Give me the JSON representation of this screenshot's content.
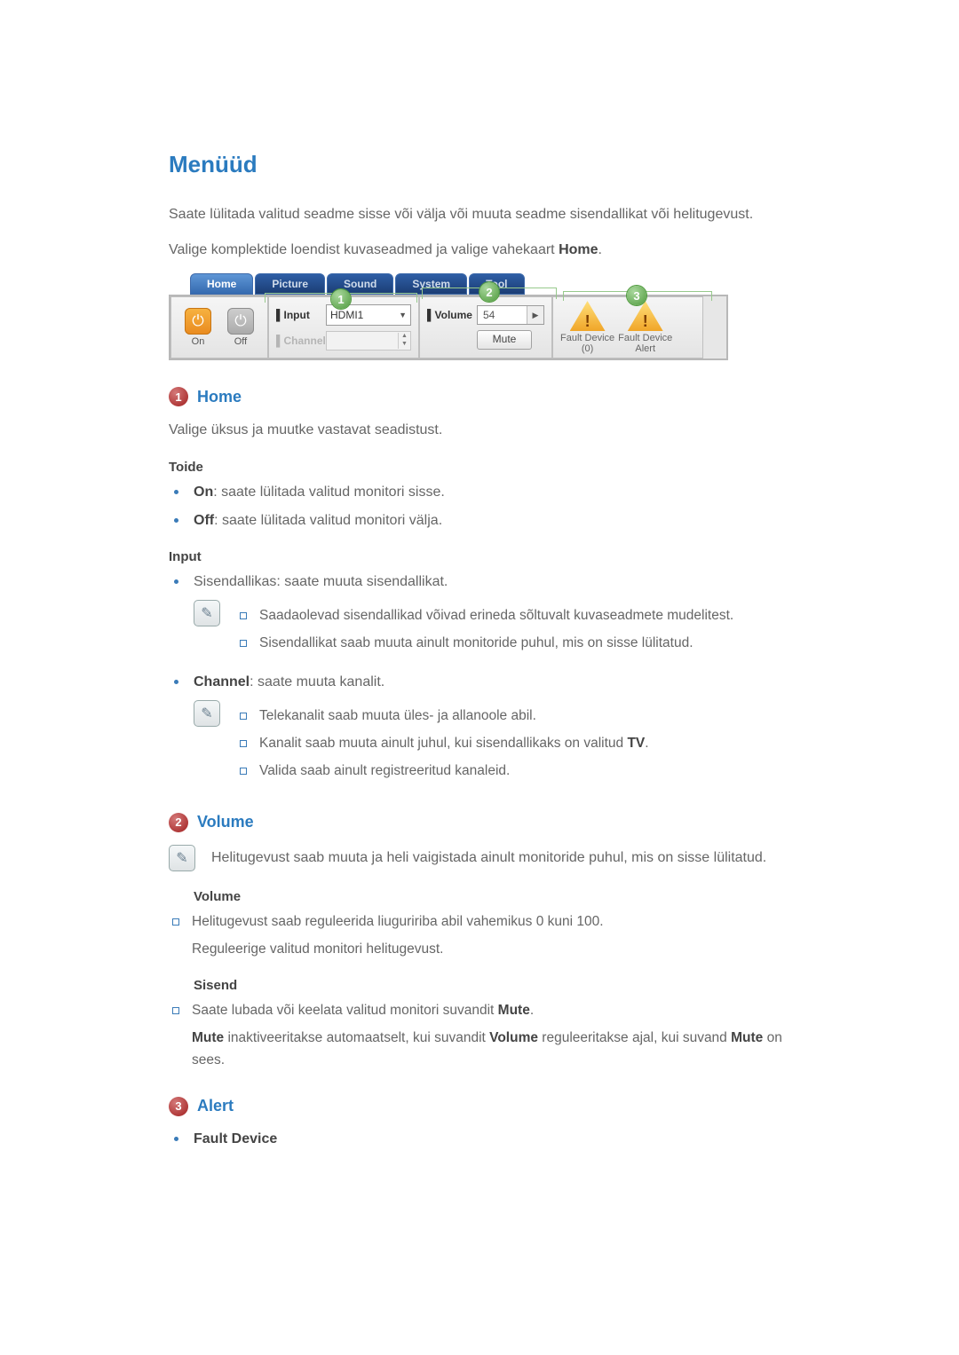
{
  "title": "Menüüd",
  "intro1": "Saate lülitada valitud seadme sisse või välja või muuta seadme sisendallikat või helitugevust.",
  "intro2_pre": "Valige komplektide loendist kuvaseadmed ja valige vahekaart ",
  "intro2_bold": "Home",
  "intro2_post": ".",
  "panel": {
    "tabs": [
      "Home",
      "Picture",
      "Sound",
      "System",
      "Tool"
    ],
    "power": {
      "on": "On",
      "off": "Off"
    },
    "input": {
      "inputLabel": "Input",
      "inputValue": "HDMI1",
      "channelLabel": "Channel"
    },
    "volume": {
      "label": "Volume",
      "value": "54",
      "mute": "Mute"
    },
    "alert": {
      "col1a": "Fault Device",
      "col1b": "(0)",
      "col2a": "Fault Device",
      "col2b": "Alert"
    },
    "badges": {
      "b1": "1",
      "b2": "2",
      "b3": "3"
    }
  },
  "s1": {
    "num": "1",
    "title": "Home",
    "intro": "Valige üksus ja muutke vastavat seadistust.",
    "power": {
      "head": "Toide",
      "on_b": "On",
      "on_t": ": saate lülitada valitud monitori sisse.",
      "off_b": "Off",
      "off_t": ": saate lülitada valitud monitori välja."
    },
    "input": {
      "head": "Input",
      "src": "Sisendallikas: saate muuta sisendallikat.",
      "n1": "Saadaolevad sisendallikad võivad erineda sõltuvalt kuvaseadmete mudelitest.",
      "n2": "Sisendallikat saab muuta ainult monitoride puhul, mis on sisse lülitatud.",
      "ch_b": "Channel",
      "ch_t": ": saate muuta kanalit.",
      "cn1": "Telekanalit saab muuta üles- ja allanoole abil.",
      "cn2_pre": "Kanalit saab muuta ainult juhul, kui sisendallikaks on valitud ",
      "cn2_b": "TV",
      "cn2_post": ".",
      "cn3": "Valida saab ainult registreeritud kanaleid."
    }
  },
  "s2": {
    "num": "2",
    "title": "Volume",
    "note": "Helitugevust saab muuta ja heli vaigistada ainult monitoride puhul, mis on sisse lülitatud.",
    "vol": {
      "head": "Volume",
      "l1": "Helitugevust saab reguleerida liuguririba abil vahemikus 0 kuni 100.",
      "l2": "Reguleerige valitud monitori helitugevust."
    },
    "mute": {
      "head": "Sisend",
      "l1_pre": "Saate lubada või keelata valitud monitori suvandit ",
      "l1_b": "Mute",
      "l1_post": ".",
      "l2_b1": "Mute",
      "l2_t1": " inaktiveeritakse automaatselt, kui suvandit ",
      "l2_b2": "Volume",
      "l2_t2": " reguleeritakse ajal, kui suvand ",
      "l2_b3": "Mute",
      "l2_t3": " on sees."
    }
  },
  "s3": {
    "num": "3",
    "title": "Alert",
    "item": "Fault Device"
  }
}
